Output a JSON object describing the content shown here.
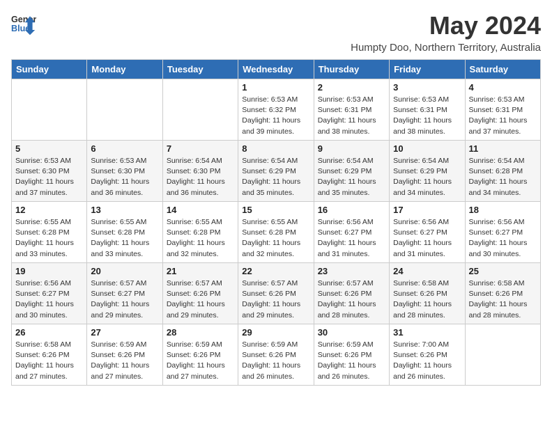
{
  "header": {
    "logo_line1": "General",
    "logo_line2": "Blue",
    "month_title": "May 2024",
    "subtitle": "Humpty Doo, Northern Territory, Australia"
  },
  "weekdays": [
    "Sunday",
    "Monday",
    "Tuesday",
    "Wednesday",
    "Thursday",
    "Friday",
    "Saturday"
  ],
  "weeks": [
    [
      {
        "day": "",
        "info": ""
      },
      {
        "day": "",
        "info": ""
      },
      {
        "day": "",
        "info": ""
      },
      {
        "day": "1",
        "info": "Sunrise: 6:53 AM\nSunset: 6:32 PM\nDaylight: 11 hours\nand 39 minutes."
      },
      {
        "day": "2",
        "info": "Sunrise: 6:53 AM\nSunset: 6:31 PM\nDaylight: 11 hours\nand 38 minutes."
      },
      {
        "day": "3",
        "info": "Sunrise: 6:53 AM\nSunset: 6:31 PM\nDaylight: 11 hours\nand 38 minutes."
      },
      {
        "day": "4",
        "info": "Sunrise: 6:53 AM\nSunset: 6:31 PM\nDaylight: 11 hours\nand 37 minutes."
      }
    ],
    [
      {
        "day": "5",
        "info": "Sunrise: 6:53 AM\nSunset: 6:30 PM\nDaylight: 11 hours\nand 37 minutes."
      },
      {
        "day": "6",
        "info": "Sunrise: 6:53 AM\nSunset: 6:30 PM\nDaylight: 11 hours\nand 36 minutes."
      },
      {
        "day": "7",
        "info": "Sunrise: 6:54 AM\nSunset: 6:30 PM\nDaylight: 11 hours\nand 36 minutes."
      },
      {
        "day": "8",
        "info": "Sunrise: 6:54 AM\nSunset: 6:29 PM\nDaylight: 11 hours\nand 35 minutes."
      },
      {
        "day": "9",
        "info": "Sunrise: 6:54 AM\nSunset: 6:29 PM\nDaylight: 11 hours\nand 35 minutes."
      },
      {
        "day": "10",
        "info": "Sunrise: 6:54 AM\nSunset: 6:29 PM\nDaylight: 11 hours\nand 34 minutes."
      },
      {
        "day": "11",
        "info": "Sunrise: 6:54 AM\nSunset: 6:28 PM\nDaylight: 11 hours\nand 34 minutes."
      }
    ],
    [
      {
        "day": "12",
        "info": "Sunrise: 6:55 AM\nSunset: 6:28 PM\nDaylight: 11 hours\nand 33 minutes."
      },
      {
        "day": "13",
        "info": "Sunrise: 6:55 AM\nSunset: 6:28 PM\nDaylight: 11 hours\nand 33 minutes."
      },
      {
        "day": "14",
        "info": "Sunrise: 6:55 AM\nSunset: 6:28 PM\nDaylight: 11 hours\nand 32 minutes."
      },
      {
        "day": "15",
        "info": "Sunrise: 6:55 AM\nSunset: 6:28 PM\nDaylight: 11 hours\nand 32 minutes."
      },
      {
        "day": "16",
        "info": "Sunrise: 6:56 AM\nSunset: 6:27 PM\nDaylight: 11 hours\nand 31 minutes."
      },
      {
        "day": "17",
        "info": "Sunrise: 6:56 AM\nSunset: 6:27 PM\nDaylight: 11 hours\nand 31 minutes."
      },
      {
        "day": "18",
        "info": "Sunrise: 6:56 AM\nSunset: 6:27 PM\nDaylight: 11 hours\nand 30 minutes."
      }
    ],
    [
      {
        "day": "19",
        "info": "Sunrise: 6:56 AM\nSunset: 6:27 PM\nDaylight: 11 hours\nand 30 minutes."
      },
      {
        "day": "20",
        "info": "Sunrise: 6:57 AM\nSunset: 6:27 PM\nDaylight: 11 hours\nand 29 minutes."
      },
      {
        "day": "21",
        "info": "Sunrise: 6:57 AM\nSunset: 6:26 PM\nDaylight: 11 hours\nand 29 minutes."
      },
      {
        "day": "22",
        "info": "Sunrise: 6:57 AM\nSunset: 6:26 PM\nDaylight: 11 hours\nand 29 minutes."
      },
      {
        "day": "23",
        "info": "Sunrise: 6:57 AM\nSunset: 6:26 PM\nDaylight: 11 hours\nand 28 minutes."
      },
      {
        "day": "24",
        "info": "Sunrise: 6:58 AM\nSunset: 6:26 PM\nDaylight: 11 hours\nand 28 minutes."
      },
      {
        "day": "25",
        "info": "Sunrise: 6:58 AM\nSunset: 6:26 PM\nDaylight: 11 hours\nand 28 minutes."
      }
    ],
    [
      {
        "day": "26",
        "info": "Sunrise: 6:58 AM\nSunset: 6:26 PM\nDaylight: 11 hours\nand 27 minutes."
      },
      {
        "day": "27",
        "info": "Sunrise: 6:59 AM\nSunset: 6:26 PM\nDaylight: 11 hours\nand 27 minutes."
      },
      {
        "day": "28",
        "info": "Sunrise: 6:59 AM\nSunset: 6:26 PM\nDaylight: 11 hours\nand 27 minutes."
      },
      {
        "day": "29",
        "info": "Sunrise: 6:59 AM\nSunset: 6:26 PM\nDaylight: 11 hours\nand 26 minutes."
      },
      {
        "day": "30",
        "info": "Sunrise: 6:59 AM\nSunset: 6:26 PM\nDaylight: 11 hours\nand 26 minutes."
      },
      {
        "day": "31",
        "info": "Sunrise: 7:00 AM\nSunset: 6:26 PM\nDaylight: 11 hours\nand 26 minutes."
      },
      {
        "day": "",
        "info": ""
      }
    ]
  ]
}
